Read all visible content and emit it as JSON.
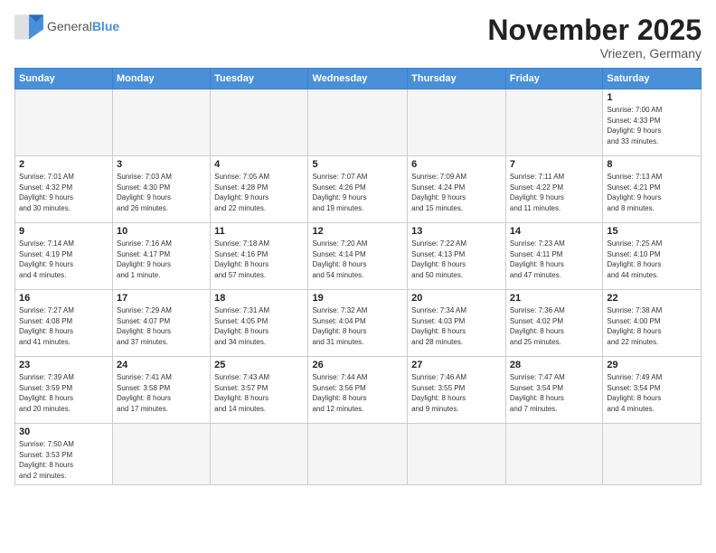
{
  "logo": {
    "text_general": "General",
    "text_blue": "Blue"
  },
  "header": {
    "month": "November 2025",
    "location": "Vriezen, Germany"
  },
  "weekdays": [
    "Sunday",
    "Monday",
    "Tuesday",
    "Wednesday",
    "Thursday",
    "Friday",
    "Saturday"
  ],
  "weeks": [
    [
      {
        "day": "",
        "info": ""
      },
      {
        "day": "",
        "info": ""
      },
      {
        "day": "",
        "info": ""
      },
      {
        "day": "",
        "info": ""
      },
      {
        "day": "",
        "info": ""
      },
      {
        "day": "",
        "info": ""
      },
      {
        "day": "1",
        "info": "Sunrise: 7:00 AM\nSunset: 4:33 PM\nDaylight: 9 hours\nand 33 minutes."
      }
    ],
    [
      {
        "day": "2",
        "info": "Sunrise: 7:01 AM\nSunset: 4:32 PM\nDaylight: 9 hours\nand 30 minutes."
      },
      {
        "day": "3",
        "info": "Sunrise: 7:03 AM\nSunset: 4:30 PM\nDaylight: 9 hours\nand 26 minutes."
      },
      {
        "day": "4",
        "info": "Sunrise: 7:05 AM\nSunset: 4:28 PM\nDaylight: 9 hours\nand 22 minutes."
      },
      {
        "day": "5",
        "info": "Sunrise: 7:07 AM\nSunset: 4:26 PM\nDaylight: 9 hours\nand 19 minutes."
      },
      {
        "day": "6",
        "info": "Sunrise: 7:09 AM\nSunset: 4:24 PM\nDaylight: 9 hours\nand 15 minutes."
      },
      {
        "day": "7",
        "info": "Sunrise: 7:11 AM\nSunset: 4:22 PM\nDaylight: 9 hours\nand 11 minutes."
      },
      {
        "day": "8",
        "info": "Sunrise: 7:13 AM\nSunset: 4:21 PM\nDaylight: 9 hours\nand 8 minutes."
      }
    ],
    [
      {
        "day": "9",
        "info": "Sunrise: 7:14 AM\nSunset: 4:19 PM\nDaylight: 9 hours\nand 4 minutes."
      },
      {
        "day": "10",
        "info": "Sunrise: 7:16 AM\nSunset: 4:17 PM\nDaylight: 9 hours\nand 1 minute."
      },
      {
        "day": "11",
        "info": "Sunrise: 7:18 AM\nSunset: 4:16 PM\nDaylight: 8 hours\nand 57 minutes."
      },
      {
        "day": "12",
        "info": "Sunrise: 7:20 AM\nSunset: 4:14 PM\nDaylight: 8 hours\nand 54 minutes."
      },
      {
        "day": "13",
        "info": "Sunrise: 7:22 AM\nSunset: 4:13 PM\nDaylight: 8 hours\nand 50 minutes."
      },
      {
        "day": "14",
        "info": "Sunrise: 7:23 AM\nSunset: 4:11 PM\nDaylight: 8 hours\nand 47 minutes."
      },
      {
        "day": "15",
        "info": "Sunrise: 7:25 AM\nSunset: 4:10 PM\nDaylight: 8 hours\nand 44 minutes."
      }
    ],
    [
      {
        "day": "16",
        "info": "Sunrise: 7:27 AM\nSunset: 4:08 PM\nDaylight: 8 hours\nand 41 minutes."
      },
      {
        "day": "17",
        "info": "Sunrise: 7:29 AM\nSunset: 4:07 PM\nDaylight: 8 hours\nand 37 minutes."
      },
      {
        "day": "18",
        "info": "Sunrise: 7:31 AM\nSunset: 4:05 PM\nDaylight: 8 hours\nand 34 minutes."
      },
      {
        "day": "19",
        "info": "Sunrise: 7:32 AM\nSunset: 4:04 PM\nDaylight: 8 hours\nand 31 minutes."
      },
      {
        "day": "20",
        "info": "Sunrise: 7:34 AM\nSunset: 4:03 PM\nDaylight: 8 hours\nand 28 minutes."
      },
      {
        "day": "21",
        "info": "Sunrise: 7:36 AM\nSunset: 4:02 PM\nDaylight: 8 hours\nand 25 minutes."
      },
      {
        "day": "22",
        "info": "Sunrise: 7:38 AM\nSunset: 4:00 PM\nDaylight: 8 hours\nand 22 minutes."
      }
    ],
    [
      {
        "day": "23",
        "info": "Sunrise: 7:39 AM\nSunset: 3:59 PM\nDaylight: 8 hours\nand 20 minutes."
      },
      {
        "day": "24",
        "info": "Sunrise: 7:41 AM\nSunset: 3:58 PM\nDaylight: 8 hours\nand 17 minutes."
      },
      {
        "day": "25",
        "info": "Sunrise: 7:43 AM\nSunset: 3:57 PM\nDaylight: 8 hours\nand 14 minutes."
      },
      {
        "day": "26",
        "info": "Sunrise: 7:44 AM\nSunset: 3:56 PM\nDaylight: 8 hours\nand 12 minutes."
      },
      {
        "day": "27",
        "info": "Sunrise: 7:46 AM\nSunset: 3:55 PM\nDaylight: 8 hours\nand 9 minutes."
      },
      {
        "day": "28",
        "info": "Sunrise: 7:47 AM\nSunset: 3:54 PM\nDaylight: 8 hours\nand 7 minutes."
      },
      {
        "day": "29",
        "info": "Sunrise: 7:49 AM\nSunset: 3:54 PM\nDaylight: 8 hours\nand 4 minutes."
      }
    ],
    [
      {
        "day": "30",
        "info": "Sunrise: 7:50 AM\nSunset: 3:53 PM\nDaylight: 8 hours\nand 2 minutes."
      },
      {
        "day": "",
        "info": ""
      },
      {
        "day": "",
        "info": ""
      },
      {
        "day": "",
        "info": ""
      },
      {
        "day": "",
        "info": ""
      },
      {
        "day": "",
        "info": ""
      },
      {
        "day": "",
        "info": ""
      }
    ]
  ]
}
